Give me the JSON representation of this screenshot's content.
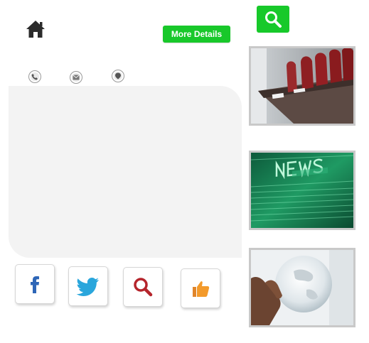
{
  "header": {
    "more_details_label": "More Details"
  },
  "icons": {
    "home": "home-icon",
    "search": "search-icon",
    "phone": "phone-icon",
    "mail": "mail-icon",
    "location": "location-icon",
    "facebook": "facebook-icon",
    "twitter": "twitter-icon",
    "magnifier": "magnifier-icon",
    "like": "thumbs-up-icon"
  },
  "thumbnails": [
    {
      "id": "meeting-room"
    },
    {
      "id": "news"
    },
    {
      "id": "globe"
    }
  ],
  "colors": {
    "accent_green": "#18c82a",
    "panel_bg": "#f3f3f3",
    "facebook_blue": "#2e66b7",
    "twitter_blue": "#2aa6dc",
    "search_red": "#b5252c",
    "like_orange": "#f39a2b"
  }
}
